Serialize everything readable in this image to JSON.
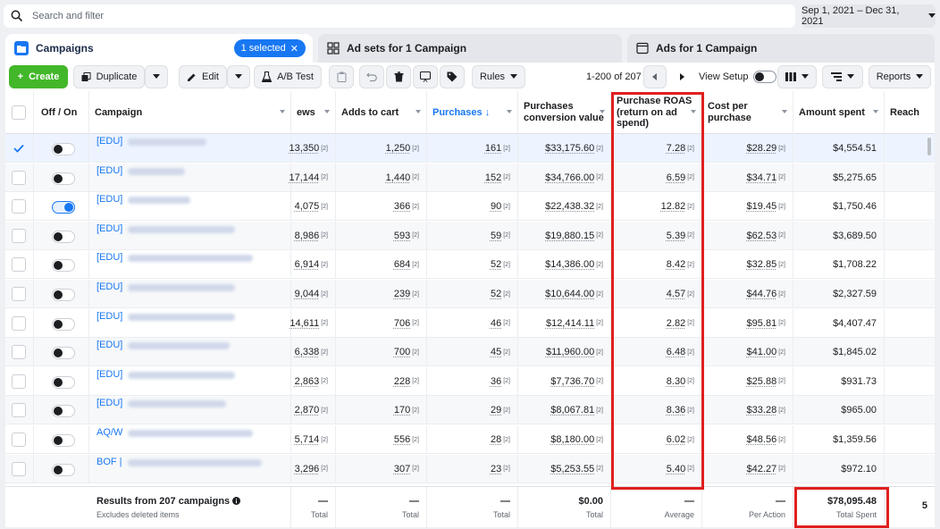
{
  "search": {
    "placeholder": "Search and filter"
  },
  "date_range": "Sep 1, 2021 – Dec 31, 2021",
  "tabs": {
    "campaigns": "Campaigns",
    "selected": "1 selected",
    "ad_sets": "Ad sets for 1 Campaign",
    "ads": "Ads for 1 Campaign"
  },
  "toolbar": {
    "create": "Create",
    "duplicate": "Duplicate",
    "edit": "Edit",
    "ab_test": "A/B Test",
    "rules": "Rules",
    "pagination": "1-200 of 207",
    "view_setup": "View Setup",
    "reports": "Reports"
  },
  "columns": {
    "off_on": "Off / On",
    "campaign": "Campaign",
    "views": "ews",
    "adds_to_cart": "Adds to cart",
    "purchases": "Purchases ↓",
    "conv_value_1": "Purchases",
    "conv_value_2": "conversion value",
    "roas_1": "Purchase ROAS",
    "roas_2": "(return on ad",
    "roas_3": "spend)",
    "cpp_1": "Cost per",
    "cpp_2": "purchase",
    "amount_spent": "Amount spent",
    "reach": "Reach"
  },
  "footnote_marker": "[2]",
  "rows": [
    {
      "name": "[EDU]",
      "views": "13,350",
      "carts": "1,250",
      "purchases": "161",
      "value": "$33,175.60",
      "roas": "7.28",
      "cpp": "$28.29",
      "spent": "$4,554.51",
      "on": false,
      "selected": true
    },
    {
      "name": "[EDU]",
      "views": "17,144",
      "carts": "1,440",
      "purchases": "152",
      "value": "$34,766.00",
      "roas": "6.59",
      "cpp": "$34.71",
      "spent": "$5,275.65",
      "on": false,
      "selected": false
    },
    {
      "name": "[EDU]",
      "views": "4,075",
      "carts": "366",
      "purchases": "90",
      "value": "$22,438.32",
      "roas": "12.82",
      "cpp": "$19.45",
      "spent": "$1,750.46",
      "on": true,
      "selected": false
    },
    {
      "name": "[EDU]",
      "views": "8,986",
      "carts": "593",
      "purchases": "59",
      "value": "$19,880.15",
      "roas": "5.39",
      "cpp": "$62.53",
      "spent": "$3,689.50",
      "on": false,
      "selected": false
    },
    {
      "name": "[EDU]",
      "views": "6,914",
      "carts": "684",
      "purchases": "52",
      "value": "$14,386.00",
      "roas": "8.42",
      "cpp": "$32.85",
      "spent": "$1,708.22",
      "on": false,
      "selected": false
    },
    {
      "name": "[EDU]",
      "views": "9,044",
      "carts": "239",
      "purchases": "52",
      "value": "$10,644.00",
      "roas": "4.57",
      "cpp": "$44.76",
      "spent": "$2,327.59",
      "on": false,
      "selected": false
    },
    {
      "name": "[EDU]",
      "views": "14,611",
      "carts": "706",
      "purchases": "46",
      "value": "$12,414.11",
      "roas": "2.82",
      "cpp": "$95.81",
      "spent": "$4,407.47",
      "on": false,
      "selected": false
    },
    {
      "name": "[EDU]",
      "views": "6,338",
      "carts": "700",
      "purchases": "45",
      "value": "$11,960.00",
      "roas": "6.48",
      "cpp": "$41.00",
      "spent": "$1,845.02",
      "on": false,
      "selected": false
    },
    {
      "name": "[EDU]",
      "views": "2,863",
      "carts": "228",
      "purchases": "36",
      "value": "$7,736.70",
      "roas": "8.30",
      "cpp": "$25.88",
      "spent": "$931.73",
      "on": false,
      "selected": false
    },
    {
      "name": "[EDU]",
      "views": "2,870",
      "carts": "170",
      "purchases": "29",
      "value": "$8,067.81",
      "roas": "8.36",
      "cpp": "$33.28",
      "spent": "$965.00",
      "on": false,
      "selected": false
    },
    {
      "name": "AQ/W",
      "views": "5,714",
      "carts": "556",
      "purchases": "28",
      "value": "$8,180.00",
      "roas": "6.02",
      "cpp": "$48.56",
      "spent": "$1,359.56",
      "on": false,
      "selected": false
    },
    {
      "name": "BOF |",
      "views": "3,296",
      "carts": "307",
      "purchases": "23",
      "value": "$5,253.55",
      "roas": "5.40",
      "cpp": "$42.27",
      "spent": "$972.10",
      "on": false,
      "selected": false
    }
  ],
  "footer": {
    "results": "Results from 207 campaigns",
    "excludes": "Excludes deleted items",
    "views_v": "—",
    "views_l": "Total",
    "carts_v": "—",
    "carts_l": "Total",
    "purch_v": "—",
    "purch_l": "Total",
    "value_v": "$0.00",
    "value_l": "Total",
    "roas_v": "—",
    "roas_l": "Average",
    "cpp_v": "—",
    "cpp_l": "Per Action",
    "spent_v": "$78,095.48",
    "spent_l": "Total Spent",
    "reach_v": "5"
  },
  "colors": {
    "accent": "#1877f2",
    "create": "#42b72a",
    "highlight": "#e0201e"
  }
}
